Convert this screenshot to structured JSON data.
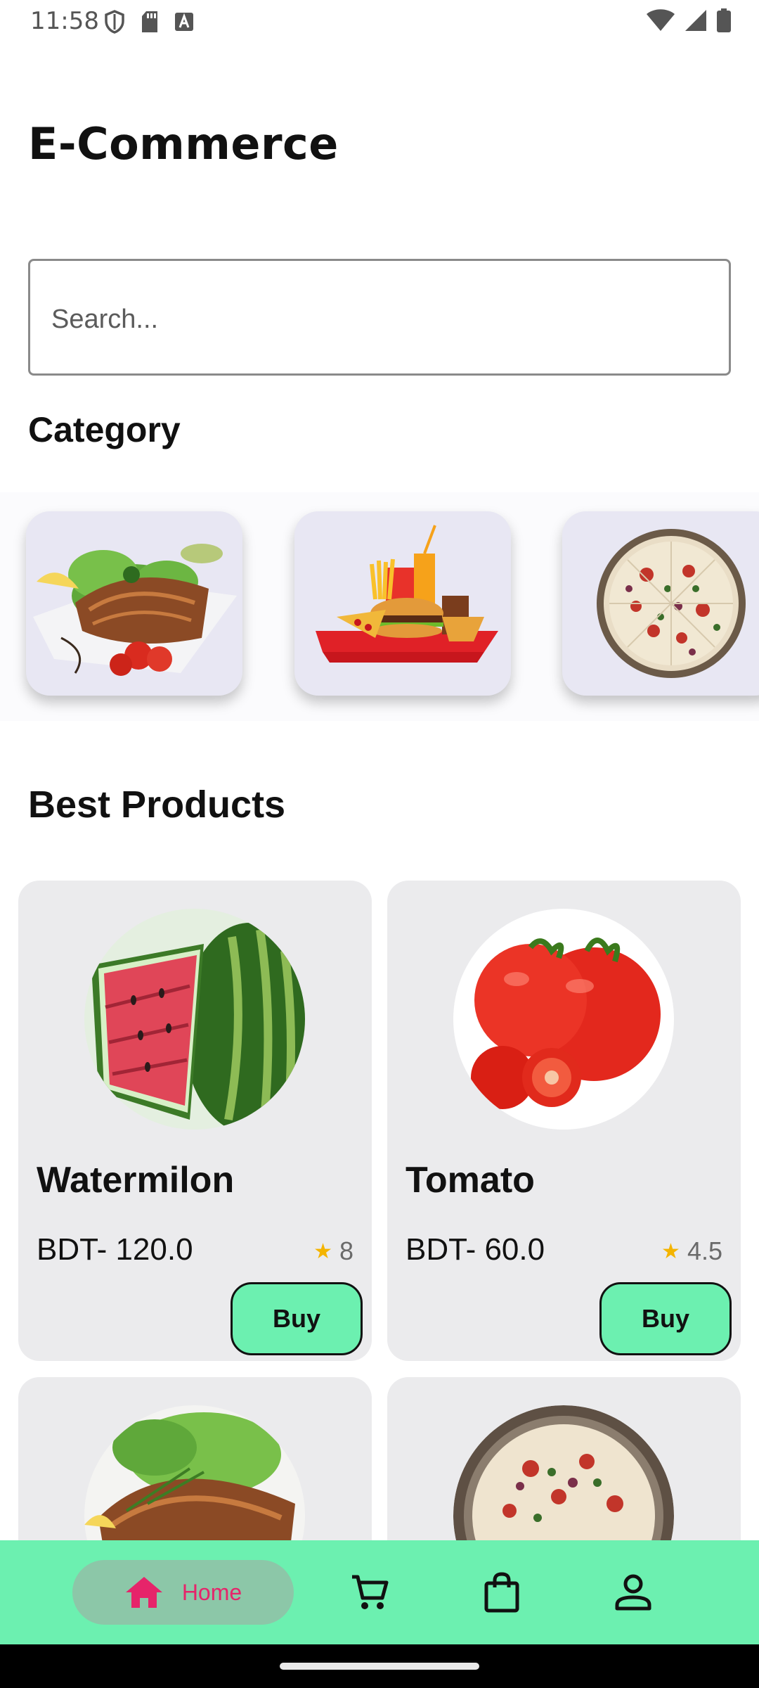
{
  "status_bar": {
    "time": "11:58",
    "left_icons": [
      "shield-icon",
      "sd-card-icon",
      "font-icon"
    ],
    "right_icons": [
      "wifi-icon",
      "signal-icon",
      "battery-icon"
    ]
  },
  "header": {
    "title": "E-Commerce"
  },
  "search": {
    "placeholder": "Search...",
    "value": ""
  },
  "category": {
    "title": "Category",
    "items": [
      {
        "icon": "salmon-salad-image"
      },
      {
        "icon": "fast-food-image"
      },
      {
        "icon": "pizza-image"
      }
    ]
  },
  "best_products": {
    "title": "Best Products",
    "items": [
      {
        "name": "Watermilon",
        "price": "BDT- 120.0",
        "rating": "8",
        "buy_label": "Buy",
        "image": "watermelon-image"
      },
      {
        "name": "Tomato",
        "price": "BDT- 60.0",
        "rating": "4.5",
        "buy_label": "Buy",
        "image": "tomato-image"
      },
      {
        "image": "salmon-image"
      },
      {
        "image": "pizza-image"
      }
    ]
  },
  "bottom_nav": {
    "items": [
      {
        "label": "Home",
        "icon": "home-icon",
        "active": true
      },
      {
        "icon": "cart-icon"
      },
      {
        "icon": "shopping-bag-icon"
      },
      {
        "icon": "profile-icon"
      }
    ]
  },
  "colors": {
    "accent": "#6cf0b0",
    "active_nav_pill": "#8cc7a8",
    "active_nav_text": "#e6246a",
    "card_bg": "#ebebed",
    "category_card_bg": "#e8e7f3",
    "star": "#f4b400"
  }
}
